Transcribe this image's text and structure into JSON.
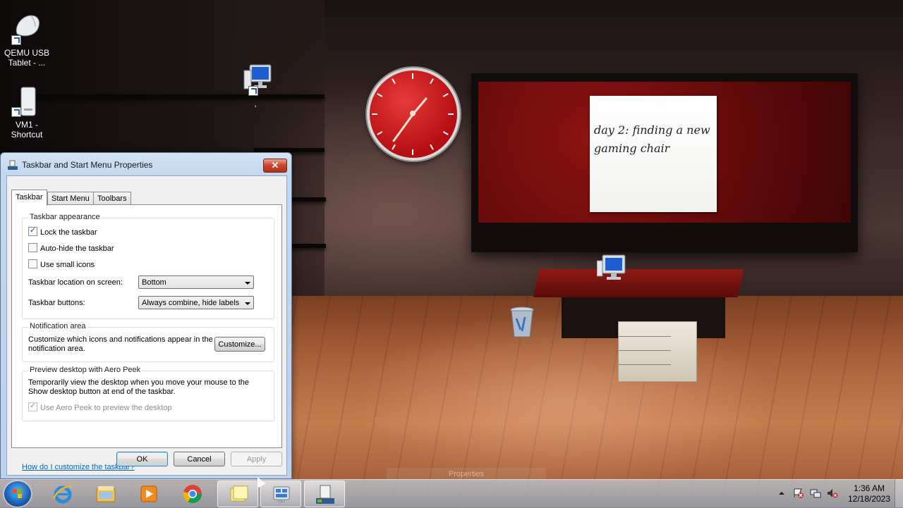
{
  "desktop": {
    "icons": [
      {
        "label": "QEMU USB Tablet - ..."
      },
      {
        "label": "VM1 - Shortcut"
      },
      {
        "label": ","
      }
    ],
    "sticky_note": {
      "text": "day 2: finding a new gaming chair"
    },
    "ghost_tooltip": "Properties"
  },
  "dialog": {
    "title": "Taskbar and Start Menu Properties",
    "close_label": "✕",
    "tabs": [
      {
        "label": "Taskbar",
        "active": true
      },
      {
        "label": "Start Menu",
        "active": false
      },
      {
        "label": "Toolbars",
        "active": false
      }
    ],
    "appearance": {
      "title": "Taskbar appearance",
      "lock": {
        "label": "Lock the taskbar",
        "checked": true
      },
      "autohide": {
        "label": "Auto-hide the taskbar",
        "checked": false
      },
      "small_icons": {
        "label": "Use small icons",
        "checked": false
      },
      "location_label": "Taskbar location on screen:",
      "location_value": "Bottom",
      "buttons_label": "Taskbar buttons:",
      "buttons_value": "Always combine, hide labels"
    },
    "notification": {
      "title": "Notification area",
      "desc_line1": "Customize which icons and notifications appear in the",
      "desc_line2": "notification area.",
      "customize_label": "Customize..."
    },
    "aero_peek": {
      "title": "Preview desktop with Aero Peek",
      "desc_line1": "Temporarily view the desktop when you move your mouse to the",
      "desc_line2": "Show desktop button at end of the taskbar.",
      "checkbox_label": "Use Aero Peek to preview the desktop",
      "checked": true,
      "enabled": false
    },
    "help_link": "How do I customize the taskbar?",
    "ok_label": "OK",
    "cancel_label": "Cancel",
    "apply_label": "Apply"
  },
  "taskbar": {
    "pinned": [
      {
        "icon": "internet-explorer-icon"
      },
      {
        "icon": "file-explorer-icon"
      },
      {
        "icon": "media-player-icon"
      },
      {
        "icon": "chrome-icon"
      },
      {
        "icon": "sticky-notes-icon",
        "active": true
      },
      {
        "icon": "gadgets-icon",
        "active": true
      },
      {
        "icon": "taskbar-properties-icon",
        "active": true
      }
    ],
    "time": "1:36 AM",
    "date": "12/18/2023"
  },
  "colors": {
    "dialog_frame": "#c3d7ee",
    "link": "#0066cc",
    "close_red": "#c7452a",
    "clock_red": "#b40d12"
  }
}
